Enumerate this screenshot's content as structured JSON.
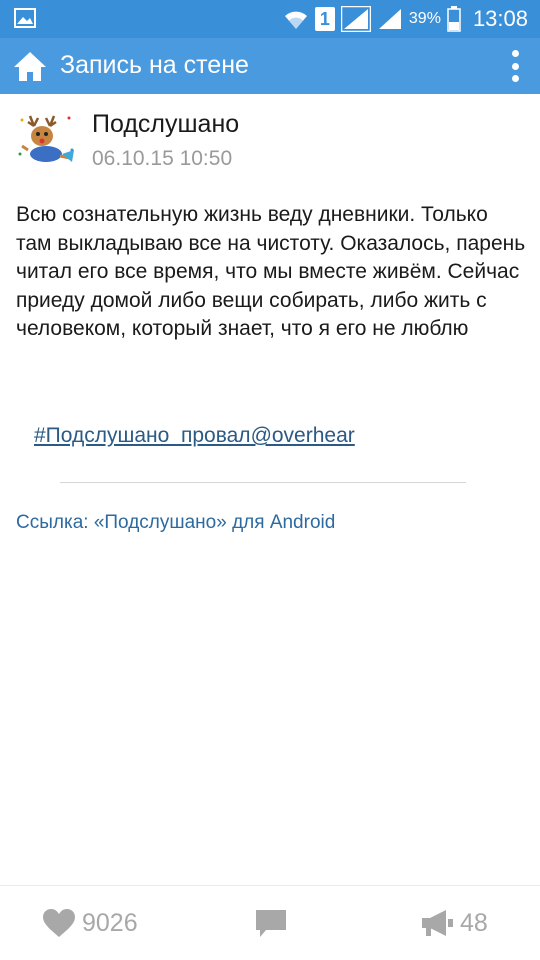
{
  "status_bar": {
    "battery_percent": "39%",
    "time": "13:08",
    "sim_label": "1",
    "icons": [
      "gallery-icon",
      "wifi-icon",
      "sim-icon",
      "signal-icon",
      "signal-icon",
      "battery-icon"
    ]
  },
  "app_bar": {
    "title": "Запись на стене",
    "color": "#4a9ae0",
    "icons": [
      "home-icon",
      "more-vert-icon"
    ]
  },
  "post": {
    "author": "Подслушано",
    "date": "06.10.15 10:50",
    "text": "Всю сознательную жизнь веду дневники. Только там выкладываю все на чистоту. Оказалось, парень читал его все время, что мы вместе живём. Сейчас приеду домой либо вещи собирать, либо жить с человеком, который знает, что я его не люблю",
    "hashtag": "#Подслушано_провал@overhear",
    "source_link": "Ссылка: «Подслушано» для Android"
  },
  "actions": {
    "likes": "9026",
    "reposts": "48",
    "icons": [
      "heart-icon",
      "comment-icon",
      "megaphone-icon"
    ]
  }
}
